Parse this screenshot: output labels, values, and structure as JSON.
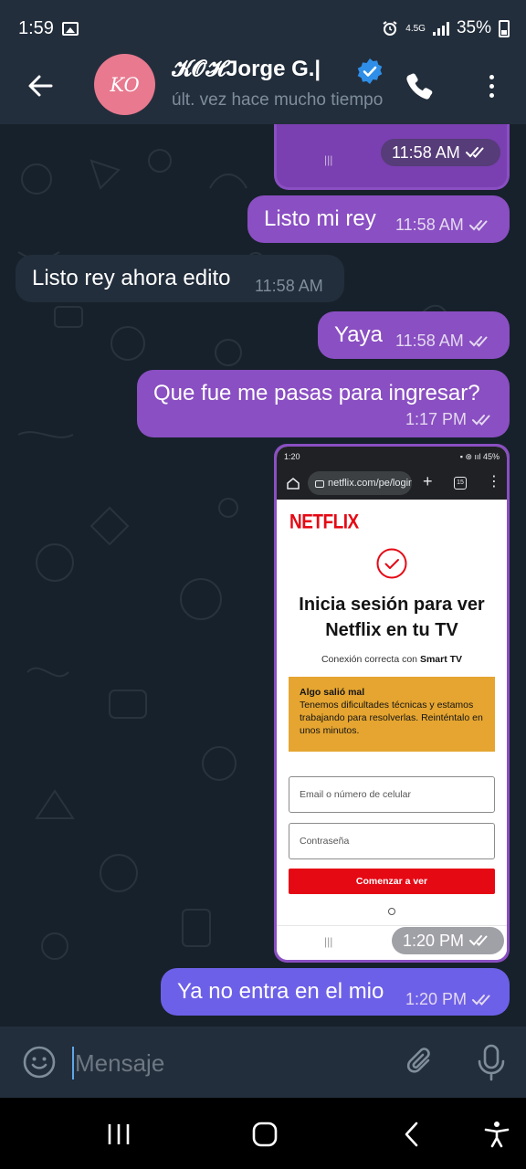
{
  "status_bar": {
    "time": "1:59",
    "net_top": "4.5G",
    "battery": "35%"
  },
  "header": {
    "avatar_initials": "KO",
    "contact_name": "𝓚𝓞𝓗Jorge G.|",
    "contact_status": "últ. vez hace mucho tiempo"
  },
  "messages": [
    {
      "text": "",
      "time": "11:58 AM"
    },
    {
      "text": "Listo mi rey",
      "time": "11:58 AM"
    },
    {
      "text": "Listo rey ahora edito",
      "time": "11:58 AM"
    },
    {
      "text": "Yaya",
      "time": "11:58 AM"
    },
    {
      "text": "Que fue me pasas para ingresar?",
      "time": "1:17 PM"
    },
    {
      "text": "",
      "time": "1:20 PM"
    },
    {
      "text": "Ya no entra en el mio",
      "time": "1:20 PM"
    }
  ],
  "screenshot": {
    "status_time": "1:20",
    "status_right": "▪ ⊛ ııl 45%",
    "url": "netflix.com/pe/login",
    "tabs_count": "15",
    "logo": "NETFLIX",
    "title": "Inicia sesión para ver Netflix en tu TV",
    "subtitle_prefix": "Conexión correcta con ",
    "subtitle_bold": "Smart TV",
    "alert_title": "Algo salió mal",
    "alert_body": "Tenemos dificultades técnicas y estamos trabajando para resolverlas. Reinténtalo en unos minutos.",
    "email_placeholder": "Email o número de celular",
    "password_placeholder": "Contraseña",
    "submit_label": "Comenzar a ver"
  },
  "input": {
    "placeholder": "Mensaje"
  },
  "colors": {
    "outgoing_bubble": "#8a4fc2",
    "outgoing_last_bubble": "#6d60e8",
    "incoming_bubble": "#232e3c",
    "header_bg": "#232e3c",
    "chat_bg": "#17212b",
    "verified": "#2f8fe8",
    "avatar": "#e8798f",
    "netflix_red": "#e50914",
    "alert_bg": "#e5a530"
  },
  "icons": {
    "status": [
      "image-icon",
      "alarm-icon",
      "signal-icon",
      "battery-icon"
    ],
    "header": [
      "back-arrow-icon",
      "verified-icon",
      "phone-icon",
      "more-vertical-icon"
    ],
    "input": [
      "emoji-icon",
      "attach-icon",
      "mic-icon"
    ],
    "nav": [
      "recents-icon",
      "home-icon",
      "back-icon",
      "accessibility-icon"
    ]
  }
}
